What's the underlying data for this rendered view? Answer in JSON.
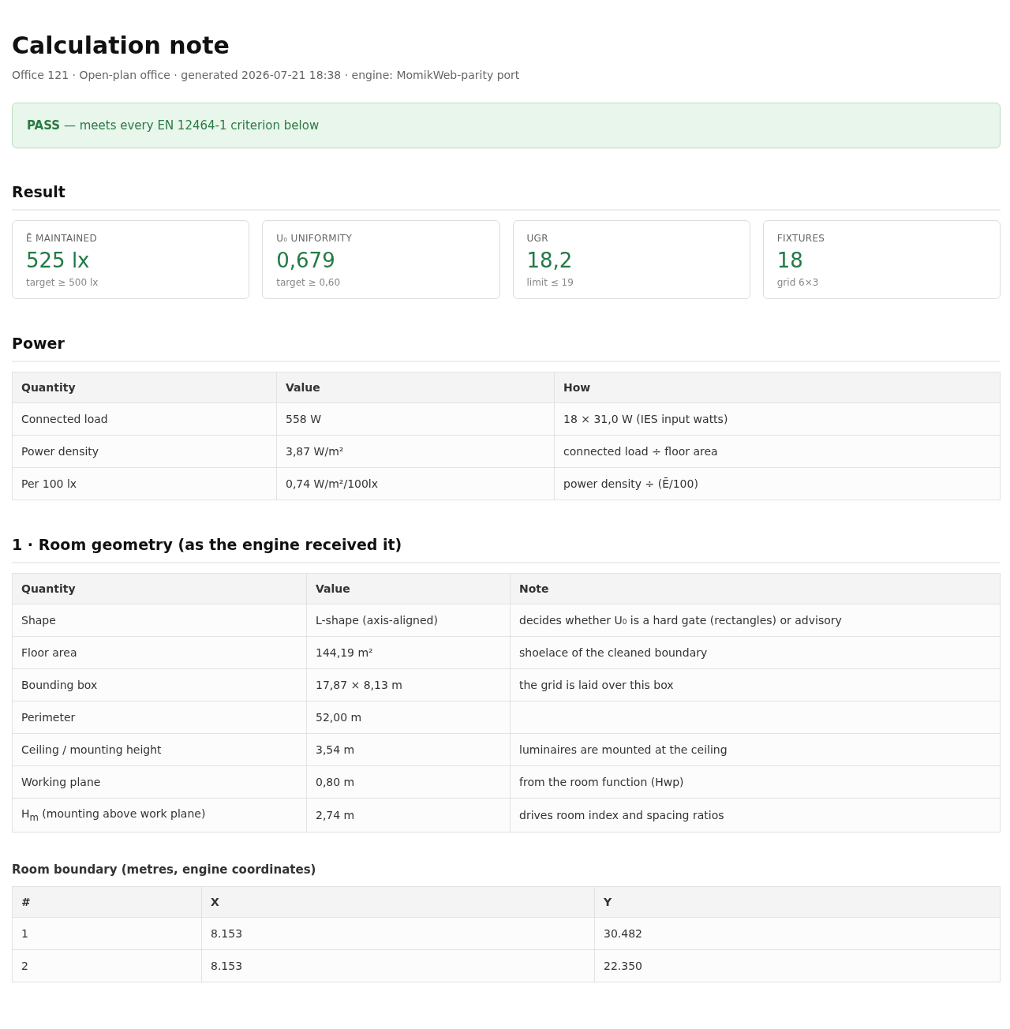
{
  "title": "Calculation note",
  "subtitle": "Office 121 · Open-plan office · generated 2026-07-21 18:38 · engine: MomikWeb-parity port",
  "verdict": {
    "passed": true,
    "label": "PASS",
    "text": "— meets every EN 12464-1 criterion below"
  },
  "result": {
    "heading": "Result",
    "cards": [
      {
        "label": "Ē MAINTAINED",
        "value": "525 lx",
        "note": "target ≥ 500 lx"
      },
      {
        "label": "U₀ UNIFORMITY",
        "value": "0,679",
        "note": "target ≥ 0,60"
      },
      {
        "label": "UGR",
        "value": "18,2",
        "note": "limit ≤ 19"
      },
      {
        "label": "FIXTURES",
        "value": "18",
        "note": "grid 6×3"
      }
    ]
  },
  "power": {
    "heading": "Power",
    "columns": [
      "Quantity",
      "Value",
      "How"
    ],
    "rows": [
      [
        "Connected load",
        "558 W",
        "18 × 31,0 W (IES input watts)"
      ],
      [
        "Power density",
        "3,87 W/m²",
        "connected load ÷ floor area"
      ],
      [
        "Per 100 lx",
        "0,74 W/m²/100lx",
        "power density ÷ (Ē/100)"
      ]
    ]
  },
  "geometry": {
    "heading": "1 · Room geometry (as the engine received it)",
    "columns": [
      "Quantity",
      "Value",
      "Note"
    ],
    "rows": [
      [
        "Shape",
        "L-shape (axis-aligned)",
        "decides whether U₀ is a hard gate (rectangles) or advisory"
      ],
      [
        "Floor area",
        "144,19 m²",
        "shoelace of the cleaned boundary"
      ],
      [
        "Bounding box",
        "17,87 × 8,13 m",
        "the grid is laid over this box"
      ],
      [
        "Perimeter",
        "52,00 m"
      ],
      [
        "Ceiling / mounting height",
        "3,54 m",
        "luminaires are mounted at the ceiling"
      ],
      [
        "Working plane",
        "0,80 m",
        "from the room function (Hwp)"
      ],
      [
        "H$_{m}$ (mounting above work plane)",
        "2,74 m",
        "drives room index and spacing ratios"
      ]
    ]
  },
  "boundary": {
    "heading": "Room boundary (metres, engine coordinates)",
    "columns": [
      "#",
      "X",
      "Y"
    ],
    "rows": [
      [
        "1",
        "8.153",
        "30.482"
      ],
      [
        "2",
        "8.153",
        "22.350"
      ]
    ]
  }
}
